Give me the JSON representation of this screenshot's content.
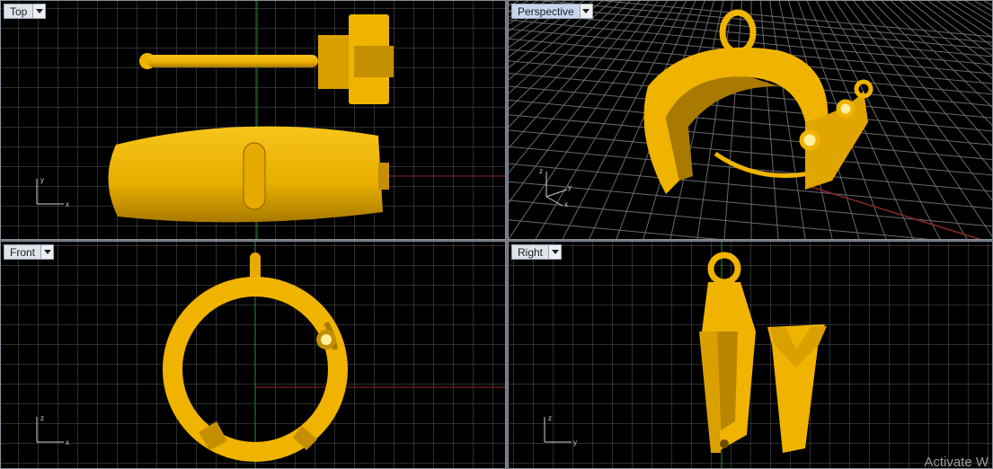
{
  "viewports": {
    "top": {
      "label": "Top",
      "axes": [
        "y",
        "x"
      ]
    },
    "perspective": {
      "label": "Perspective",
      "axes": [
        "z",
        "y",
        "x"
      ]
    },
    "front": {
      "label": "Front",
      "axes": [
        "z",
        "x"
      ]
    },
    "right": {
      "label": "Right",
      "axes": [
        "z",
        "y"
      ]
    }
  },
  "colors": {
    "model": "#f0b400",
    "model_shade": "#a87a00",
    "grid": "#5a5a5a",
    "axis_red": "#8b2a2a",
    "axis_green": "#2e8a2e",
    "viewport_bg": "#000000"
  },
  "icons": {
    "viewport_menu": "chevron-down-icon"
  },
  "watermark": "Activate W"
}
